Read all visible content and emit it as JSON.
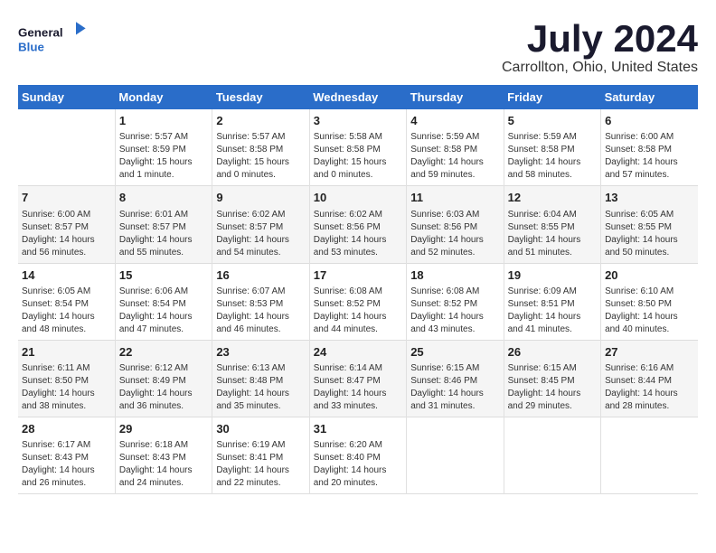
{
  "header": {
    "logo_text_general": "General",
    "logo_text_blue": "Blue",
    "month_year": "July 2024",
    "location": "Carrollton, Ohio, United States"
  },
  "days_of_week": [
    "Sunday",
    "Monday",
    "Tuesday",
    "Wednesday",
    "Thursday",
    "Friday",
    "Saturday"
  ],
  "weeks": [
    [
      {
        "day": "",
        "sunrise": "",
        "sunset": "",
        "daylight": ""
      },
      {
        "day": "1",
        "sunrise": "Sunrise: 5:57 AM",
        "sunset": "Sunset: 8:59 PM",
        "daylight": "Daylight: 15 hours and 1 minute."
      },
      {
        "day": "2",
        "sunrise": "Sunrise: 5:57 AM",
        "sunset": "Sunset: 8:58 PM",
        "daylight": "Daylight: 15 hours and 0 minutes."
      },
      {
        "day": "3",
        "sunrise": "Sunrise: 5:58 AM",
        "sunset": "Sunset: 8:58 PM",
        "daylight": "Daylight: 15 hours and 0 minutes."
      },
      {
        "day": "4",
        "sunrise": "Sunrise: 5:59 AM",
        "sunset": "Sunset: 8:58 PM",
        "daylight": "Daylight: 14 hours and 59 minutes."
      },
      {
        "day": "5",
        "sunrise": "Sunrise: 5:59 AM",
        "sunset": "Sunset: 8:58 PM",
        "daylight": "Daylight: 14 hours and 58 minutes."
      },
      {
        "day": "6",
        "sunrise": "Sunrise: 6:00 AM",
        "sunset": "Sunset: 8:58 PM",
        "daylight": "Daylight: 14 hours and 57 minutes."
      }
    ],
    [
      {
        "day": "7",
        "sunrise": "Sunrise: 6:00 AM",
        "sunset": "Sunset: 8:57 PM",
        "daylight": "Daylight: 14 hours and 56 minutes."
      },
      {
        "day": "8",
        "sunrise": "Sunrise: 6:01 AM",
        "sunset": "Sunset: 8:57 PM",
        "daylight": "Daylight: 14 hours and 55 minutes."
      },
      {
        "day": "9",
        "sunrise": "Sunrise: 6:02 AM",
        "sunset": "Sunset: 8:57 PM",
        "daylight": "Daylight: 14 hours and 54 minutes."
      },
      {
        "day": "10",
        "sunrise": "Sunrise: 6:02 AM",
        "sunset": "Sunset: 8:56 PM",
        "daylight": "Daylight: 14 hours and 53 minutes."
      },
      {
        "day": "11",
        "sunrise": "Sunrise: 6:03 AM",
        "sunset": "Sunset: 8:56 PM",
        "daylight": "Daylight: 14 hours and 52 minutes."
      },
      {
        "day": "12",
        "sunrise": "Sunrise: 6:04 AM",
        "sunset": "Sunset: 8:55 PM",
        "daylight": "Daylight: 14 hours and 51 minutes."
      },
      {
        "day": "13",
        "sunrise": "Sunrise: 6:05 AM",
        "sunset": "Sunset: 8:55 PM",
        "daylight": "Daylight: 14 hours and 50 minutes."
      }
    ],
    [
      {
        "day": "14",
        "sunrise": "Sunrise: 6:05 AM",
        "sunset": "Sunset: 8:54 PM",
        "daylight": "Daylight: 14 hours and 48 minutes."
      },
      {
        "day": "15",
        "sunrise": "Sunrise: 6:06 AM",
        "sunset": "Sunset: 8:54 PM",
        "daylight": "Daylight: 14 hours and 47 minutes."
      },
      {
        "day": "16",
        "sunrise": "Sunrise: 6:07 AM",
        "sunset": "Sunset: 8:53 PM",
        "daylight": "Daylight: 14 hours and 46 minutes."
      },
      {
        "day": "17",
        "sunrise": "Sunrise: 6:08 AM",
        "sunset": "Sunset: 8:52 PM",
        "daylight": "Daylight: 14 hours and 44 minutes."
      },
      {
        "day": "18",
        "sunrise": "Sunrise: 6:08 AM",
        "sunset": "Sunset: 8:52 PM",
        "daylight": "Daylight: 14 hours and 43 minutes."
      },
      {
        "day": "19",
        "sunrise": "Sunrise: 6:09 AM",
        "sunset": "Sunset: 8:51 PM",
        "daylight": "Daylight: 14 hours and 41 minutes."
      },
      {
        "day": "20",
        "sunrise": "Sunrise: 6:10 AM",
        "sunset": "Sunset: 8:50 PM",
        "daylight": "Daylight: 14 hours and 40 minutes."
      }
    ],
    [
      {
        "day": "21",
        "sunrise": "Sunrise: 6:11 AM",
        "sunset": "Sunset: 8:50 PM",
        "daylight": "Daylight: 14 hours and 38 minutes."
      },
      {
        "day": "22",
        "sunrise": "Sunrise: 6:12 AM",
        "sunset": "Sunset: 8:49 PM",
        "daylight": "Daylight: 14 hours and 36 minutes."
      },
      {
        "day": "23",
        "sunrise": "Sunrise: 6:13 AM",
        "sunset": "Sunset: 8:48 PM",
        "daylight": "Daylight: 14 hours and 35 minutes."
      },
      {
        "day": "24",
        "sunrise": "Sunrise: 6:14 AM",
        "sunset": "Sunset: 8:47 PM",
        "daylight": "Daylight: 14 hours and 33 minutes."
      },
      {
        "day": "25",
        "sunrise": "Sunrise: 6:15 AM",
        "sunset": "Sunset: 8:46 PM",
        "daylight": "Daylight: 14 hours and 31 minutes."
      },
      {
        "day": "26",
        "sunrise": "Sunrise: 6:15 AM",
        "sunset": "Sunset: 8:45 PM",
        "daylight": "Daylight: 14 hours and 29 minutes."
      },
      {
        "day": "27",
        "sunrise": "Sunrise: 6:16 AM",
        "sunset": "Sunset: 8:44 PM",
        "daylight": "Daylight: 14 hours and 28 minutes."
      }
    ],
    [
      {
        "day": "28",
        "sunrise": "Sunrise: 6:17 AM",
        "sunset": "Sunset: 8:43 PM",
        "daylight": "Daylight: 14 hours and 26 minutes."
      },
      {
        "day": "29",
        "sunrise": "Sunrise: 6:18 AM",
        "sunset": "Sunset: 8:43 PM",
        "daylight": "Daylight: 14 hours and 24 minutes."
      },
      {
        "day": "30",
        "sunrise": "Sunrise: 6:19 AM",
        "sunset": "Sunset: 8:41 PM",
        "daylight": "Daylight: 14 hours and 22 minutes."
      },
      {
        "day": "31",
        "sunrise": "Sunrise: 6:20 AM",
        "sunset": "Sunset: 8:40 PM",
        "daylight": "Daylight: 14 hours and 20 minutes."
      },
      {
        "day": "",
        "sunrise": "",
        "sunset": "",
        "daylight": ""
      },
      {
        "day": "",
        "sunrise": "",
        "sunset": "",
        "daylight": ""
      },
      {
        "day": "",
        "sunrise": "",
        "sunset": "",
        "daylight": ""
      }
    ]
  ]
}
